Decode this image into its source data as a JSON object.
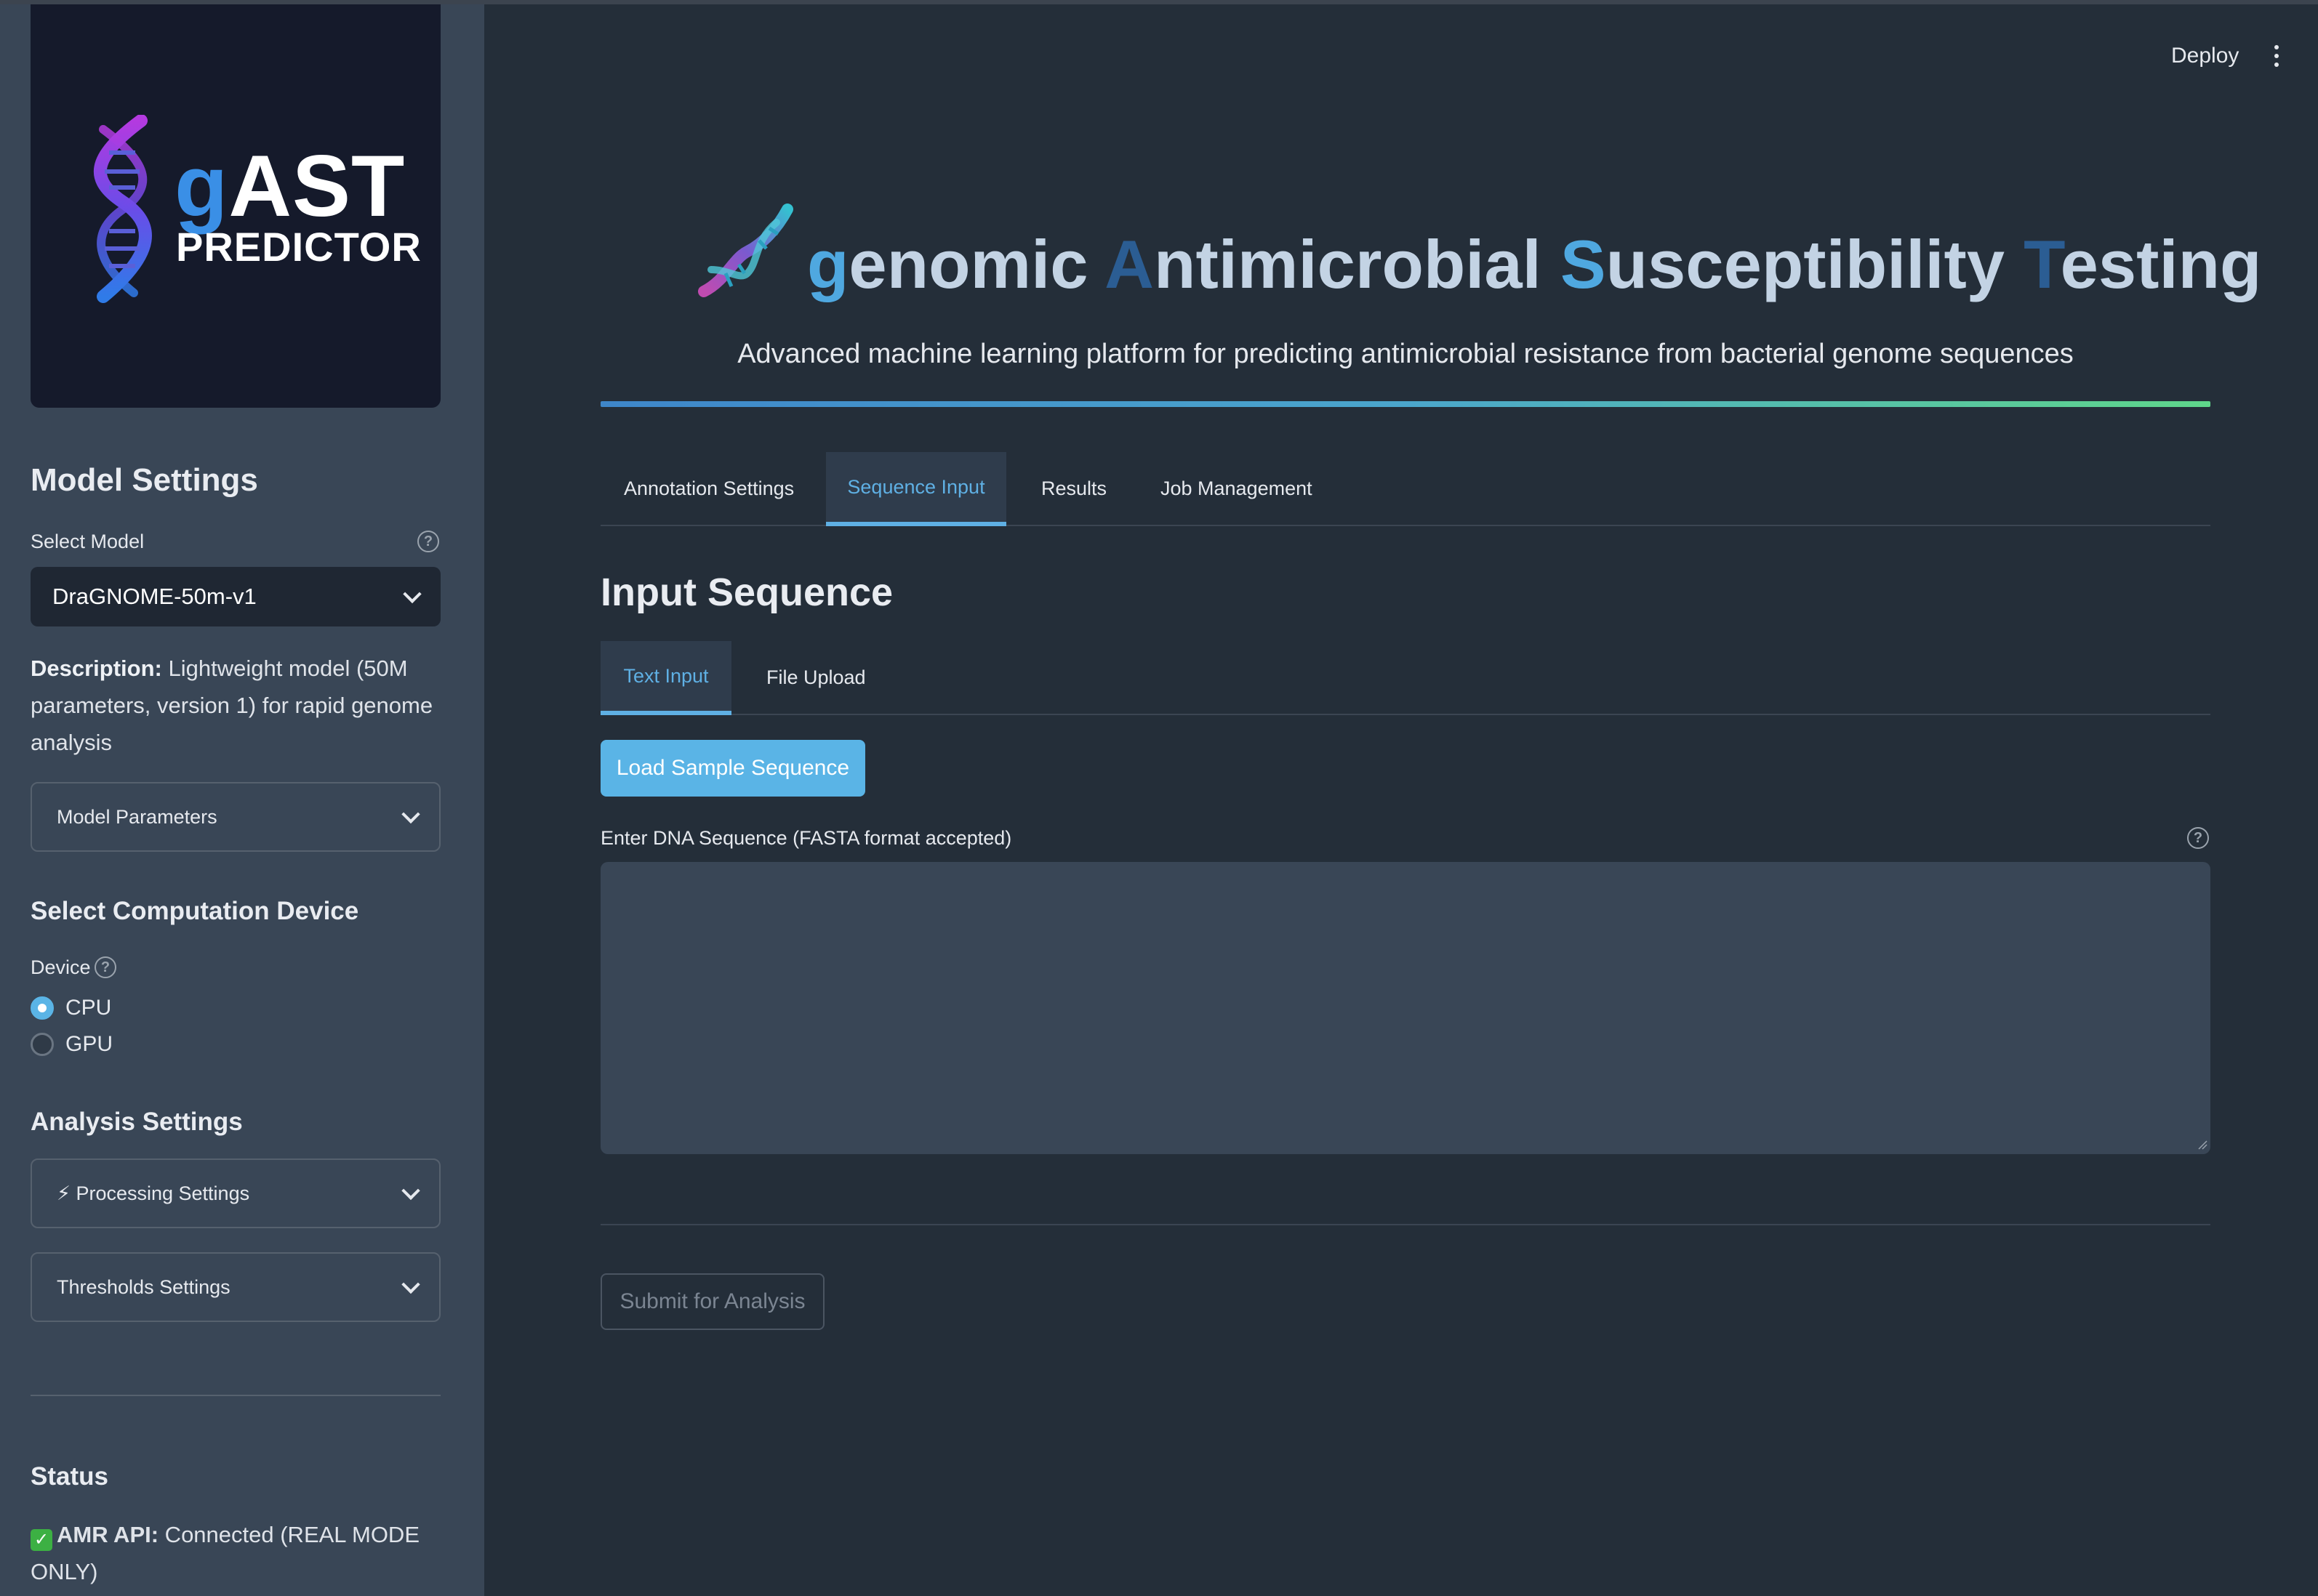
{
  "logo": {
    "g": "g",
    "ast": "AST",
    "predictor": "PREDICTOR"
  },
  "sidebar": {
    "model_settings": "Model Settings",
    "select_model_label": "Select Model",
    "selected_model": "DraGNOME-50m-v1",
    "description_label": "Description:",
    "description_text": " Lightweight model (50M parameters, version 1) for rapid genome analysis",
    "model_parameters": "Model Parameters",
    "device_heading": "Select Computation Device",
    "device_label": "Device",
    "device_options": [
      "CPU",
      "GPU"
    ],
    "device_selected": "CPU",
    "analysis_heading": "Analysis Settings",
    "processing_settings": "⚡ Processing Settings",
    "thresholds_settings": "Thresholds Settings",
    "status_heading": "Status",
    "status_label": "AMR API:",
    "status_text": " Connected (REAL MODE ONLY)"
  },
  "header": {
    "deploy": "Deploy"
  },
  "hero": {
    "title_g": "g",
    "title_1": "enomic ",
    "title_A": "A",
    "title_2": "ntimicrobial ",
    "title_S": "S",
    "title_3": "usceptibility ",
    "title_T": "T",
    "title_4": "esting",
    "subtitle": "Advanced machine learning platform for predicting antimicrobial resistance from bacterial genome sequences"
  },
  "tabs": [
    "Annotation Settings",
    "Sequence Input",
    "Results",
    "Job Management"
  ],
  "active_tab": "Sequence Input",
  "input": {
    "section_title": "Input Sequence",
    "sub_tabs": [
      "Text Input",
      "File Upload"
    ],
    "active_sub_tab": "Text Input",
    "load_sample": "Load Sample Sequence",
    "textarea_label": "Enter DNA Sequence (FASTA format accepted)",
    "textarea_value": "",
    "submit": "Submit for Analysis"
  },
  "colors": {
    "accent": "#5ab4e6",
    "background": "#242e39",
    "sidebar": "#394656"
  }
}
